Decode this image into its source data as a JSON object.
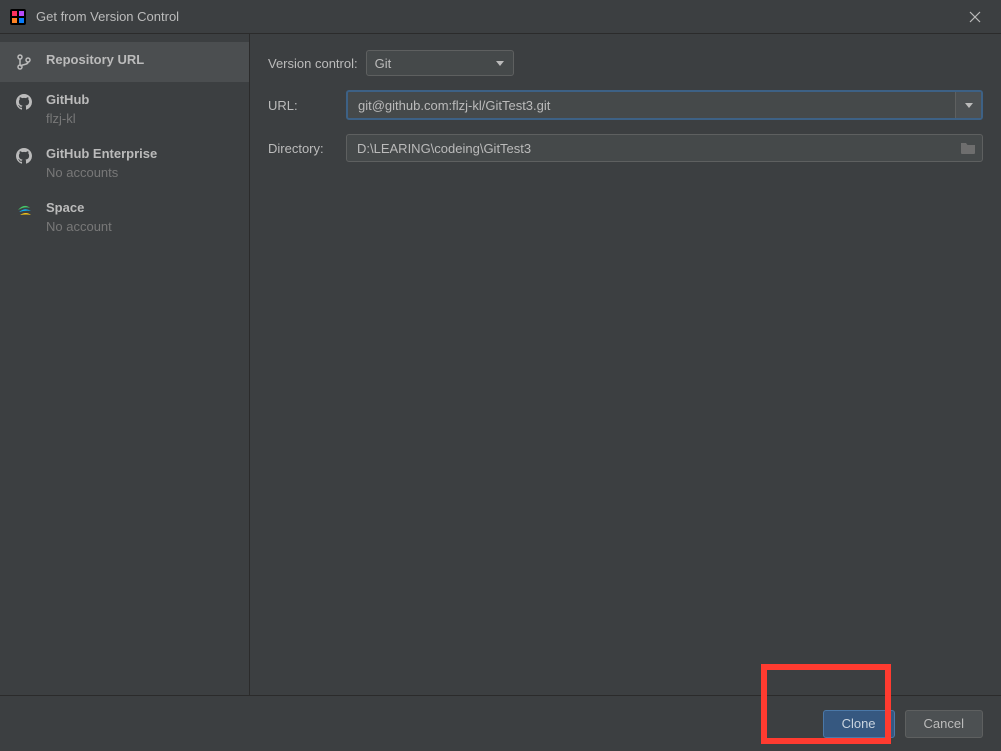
{
  "titlebar": {
    "title": "Get from Version Control"
  },
  "sidebar": {
    "items": [
      {
        "label": "Repository URL",
        "sublabel": "",
        "selected": true,
        "icon": "branch"
      },
      {
        "label": "GitHub",
        "sublabel": "flzj-kl",
        "selected": false,
        "icon": "github"
      },
      {
        "label": "GitHub Enterprise",
        "sublabel": "No accounts",
        "selected": false,
        "icon": "github"
      },
      {
        "label": "Space",
        "sublabel": "No account",
        "selected": false,
        "icon": "space"
      }
    ]
  },
  "form": {
    "version_control_label": "Version control:",
    "version_control_value": "Git",
    "url_label": "URL:",
    "url_value": "git@github.com:flzj-kl/GitTest3.git",
    "directory_label": "Directory:",
    "directory_value": "D:\\LEARING\\codeing\\GitTest3"
  },
  "buttons": {
    "clone": "Clone",
    "cancel": "Cancel"
  }
}
